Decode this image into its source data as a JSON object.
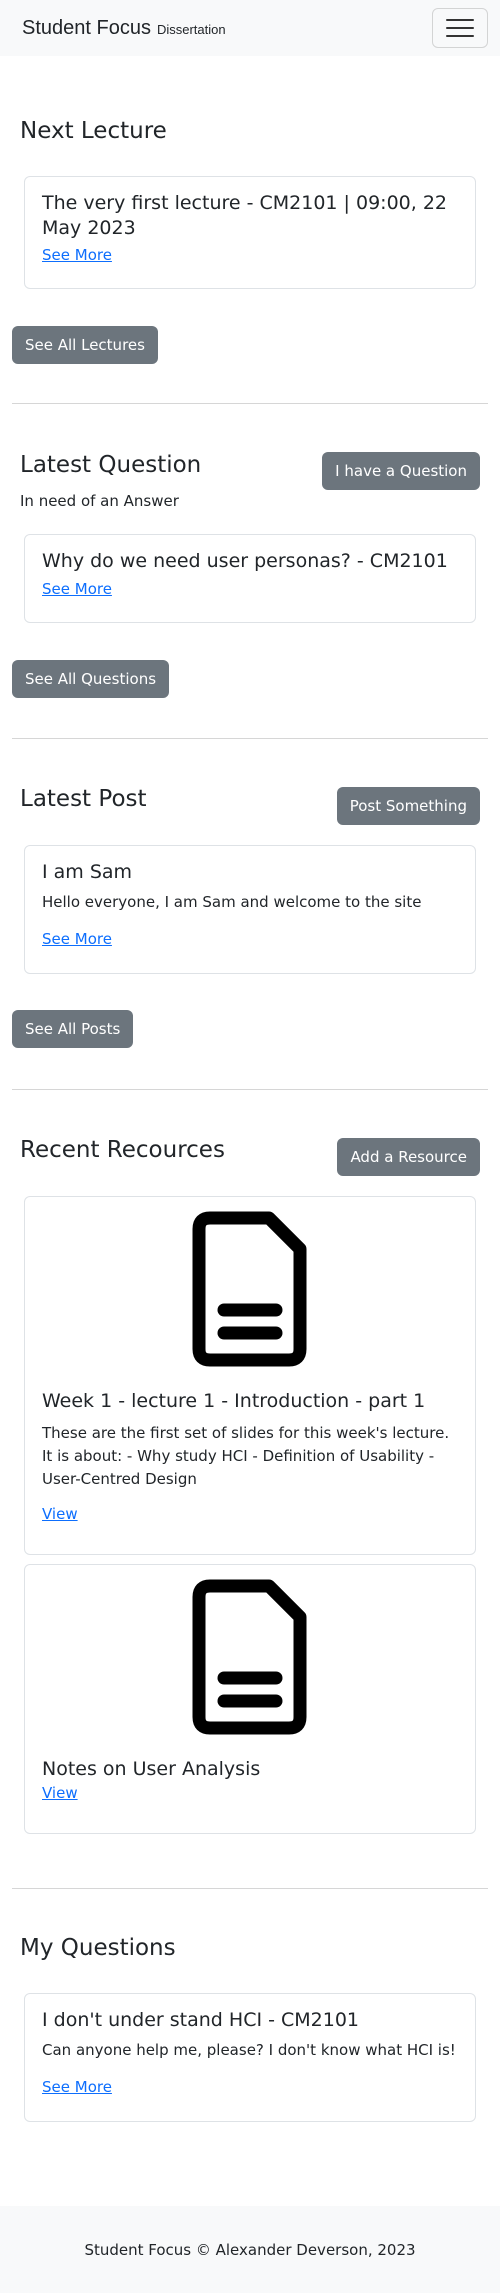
{
  "navbar": {
    "brand": "Student Focus",
    "brand_sub": "Dissertation"
  },
  "next_lecture": {
    "heading": "Next Lecture",
    "card": {
      "title": "The very first lecture - CM2101 | 09:00, 22 May 2023",
      "link": "See More"
    },
    "button": "See All Lectures"
  },
  "latest_question": {
    "heading": "Latest Question",
    "action_button": "I have a Question",
    "subtext": "In need of an Answer",
    "card": {
      "title": "Why do we need user personas? - CM2101",
      "link": "See More"
    },
    "button": "See All Questions"
  },
  "latest_post": {
    "heading": "Latest Post",
    "action_button": "Post Something",
    "card": {
      "title": "I am Sam",
      "text": "Hello everyone, I am Sam and welcome to the site",
      "link": "See More"
    },
    "button": "See All Posts"
  },
  "recent_resources": {
    "heading": "Recent Recources",
    "action_button": "Add a Resource",
    "items": [
      {
        "icon": "file-icon",
        "title": "Week 1 - lecture 1 - Introduction - part 1",
        "text": "These are the first set of slides for this week's lecture. It is about: - Why study HCI - Definition of Usability - User-Centred Design",
        "link": "View"
      },
      {
        "icon": "file-icon",
        "title": "Notes on User Analysis",
        "link": "View"
      }
    ]
  },
  "my_questions": {
    "heading": "My Questions",
    "card": {
      "title": "I don't under stand HCI - CM2101",
      "text": "Can anyone help me, please? I don't know what HCI is!",
      "link": "See More"
    }
  },
  "footer": {
    "text": "Student Focus © Alexander Deverson, 2023"
  }
}
